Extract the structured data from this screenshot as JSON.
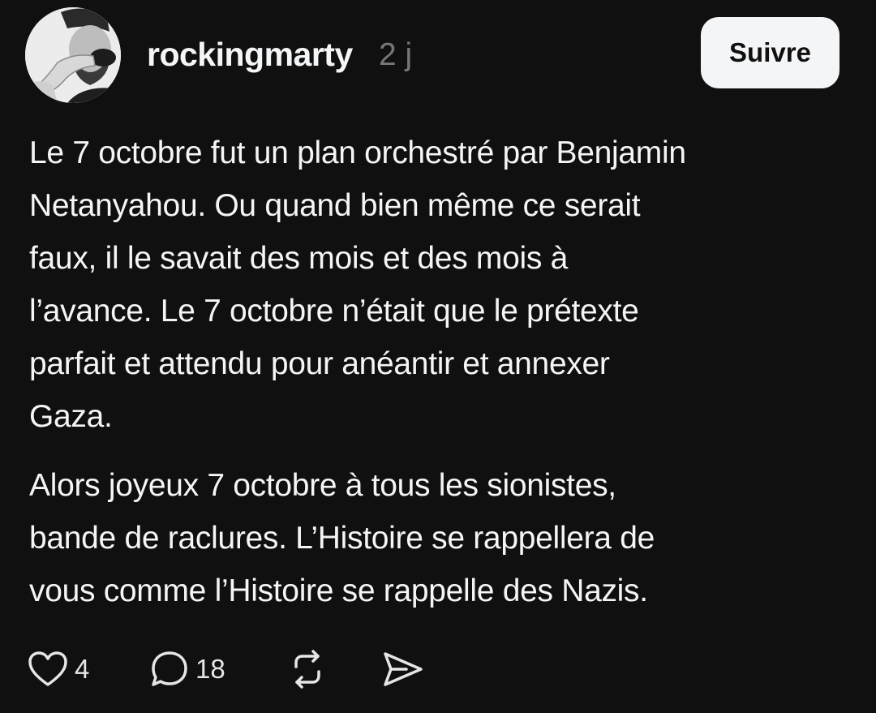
{
  "post": {
    "author": {
      "username": "rockingmarty",
      "avatar_icon": "profile-photo"
    },
    "timestamp": "2 j",
    "follow_label": "Suivre",
    "paragraphs": [
      "Le 7 octobre fut un plan orchestré par Benjamin\nNetanyahou. Ou quand bien même ce serait\nfaux, il le savait des mois et des mois à\nl’avance. Le 7 octobre n’était que le prétexte\nparfait et attendu pour anéantir et annexer\nGaza.",
      "Alors joyeux 7 octobre à tous les sionistes,\nbande de raclures. L’Histoire se rappellera de\nvous comme l’Histoire se rappelle des Nazis."
    ],
    "actions": {
      "like": {
        "icon": "heart-icon",
        "count": "4"
      },
      "comment": {
        "icon": "comment-icon",
        "count": "18"
      },
      "repost": {
        "icon": "repost-icon"
      },
      "share": {
        "icon": "send-icon"
      }
    }
  },
  "colors": {
    "background": "#101010",
    "text": "#f3f5f7",
    "muted": "#777777",
    "button_bg": "#f3f5f7"
  }
}
